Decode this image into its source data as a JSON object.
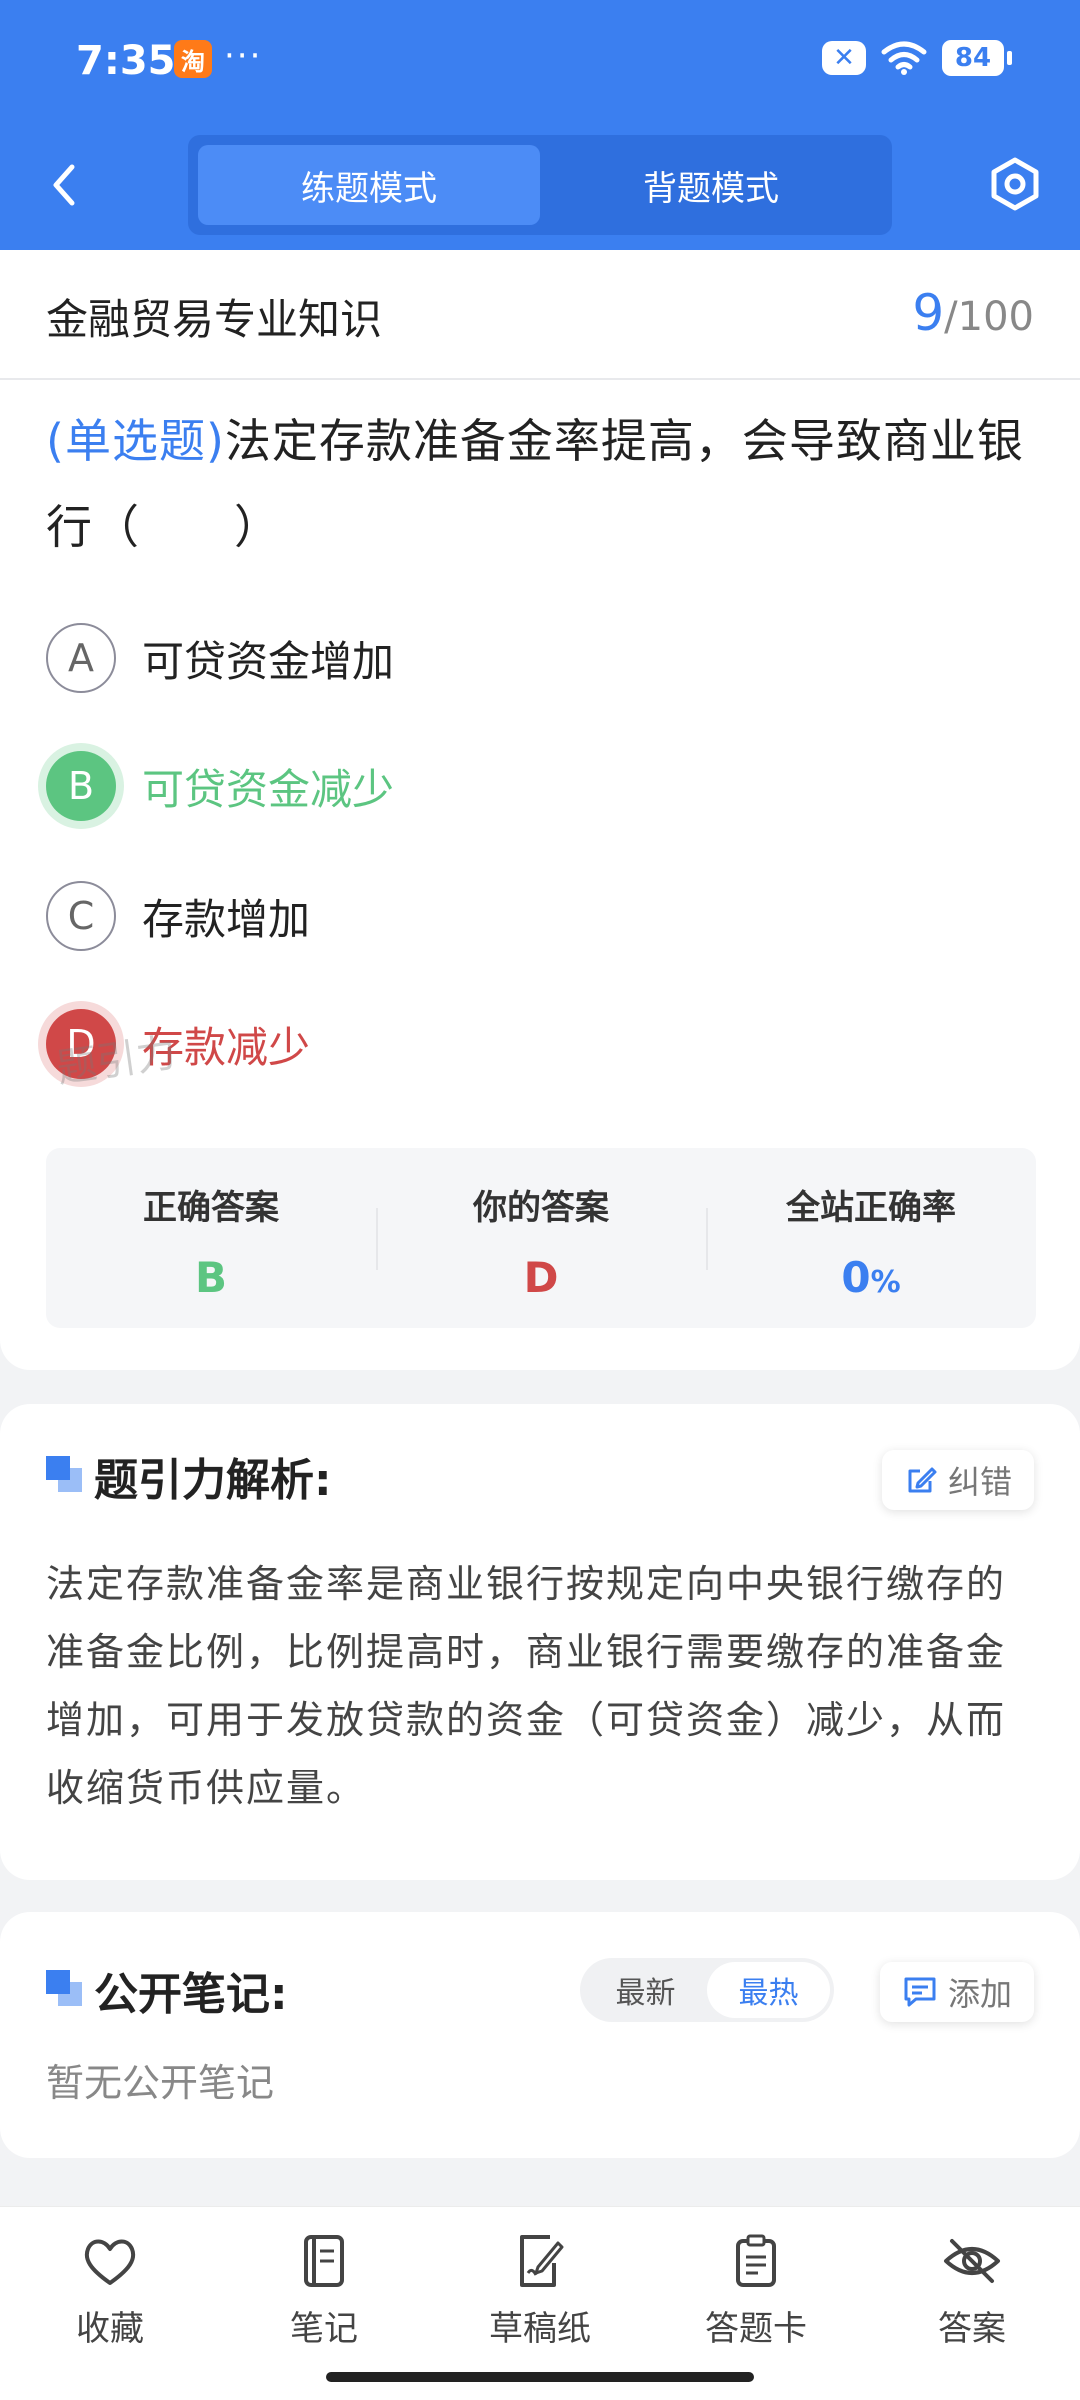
{
  "status_bar": {
    "time": "7:35",
    "app_glyph": "淘",
    "dots": "···",
    "x_badge": "✕",
    "battery": "84"
  },
  "header": {
    "tabs": [
      {
        "label": "练题模式",
        "active": true
      },
      {
        "label": "背题模式",
        "active": false
      }
    ],
    "icons": {
      "back": "chevron-left-icon",
      "settings": "hexagon-settings-icon"
    }
  },
  "question": {
    "subject": "金融贸易专业知识",
    "progress_current": "9",
    "progress_total": "/100",
    "type_label": "(单选题)",
    "text": "法定存款准备金率提高，会导致商业银行（　　）",
    "options": [
      {
        "letter": "A",
        "text": "可贷资金增加",
        "state": "normal"
      },
      {
        "letter": "B",
        "text": "可贷资金减少",
        "state": "correct"
      },
      {
        "letter": "C",
        "text": "存款增加",
        "state": "normal"
      },
      {
        "letter": "D",
        "text": "存款减少",
        "state": "wrong"
      }
    ]
  },
  "answer_summary": {
    "correct_label": "正确答案",
    "correct_value": "B",
    "yours_label": "你的答案",
    "yours_value": "D",
    "rate_label": "全站正确率",
    "rate_value": "0",
    "rate_unit": "%",
    "watermark": "题引力"
  },
  "analysis": {
    "title": "题引力解析:",
    "correct_button": "纠错",
    "text": "法定存款准备金率是商业银行按规定向中央银行缴存的准备金比例，比例提高时，商业银行需要缴存的准备金增加，可用于发放贷款的资金（可贷资金）减少，从而收缩货币供应量。"
  },
  "notes": {
    "title": "公开笔记:",
    "sort_options": [
      "最新",
      "最热"
    ],
    "sort_active": "最热",
    "add_button": "添加",
    "empty_text": "暂无公开笔记"
  },
  "bottom_nav": [
    {
      "label": "收藏",
      "icon": "heart-icon"
    },
    {
      "label": "笔记",
      "icon": "notebook-icon"
    },
    {
      "label": "草稿纸",
      "icon": "draft-paper-icon"
    },
    {
      "label": "答题卡",
      "icon": "answer-sheet-icon"
    },
    {
      "label": "答案",
      "icon": "eye-off-icon"
    }
  ],
  "colors": {
    "primary": "#3b7ff0",
    "correct": "#5cc581",
    "wrong": "#d04848"
  }
}
